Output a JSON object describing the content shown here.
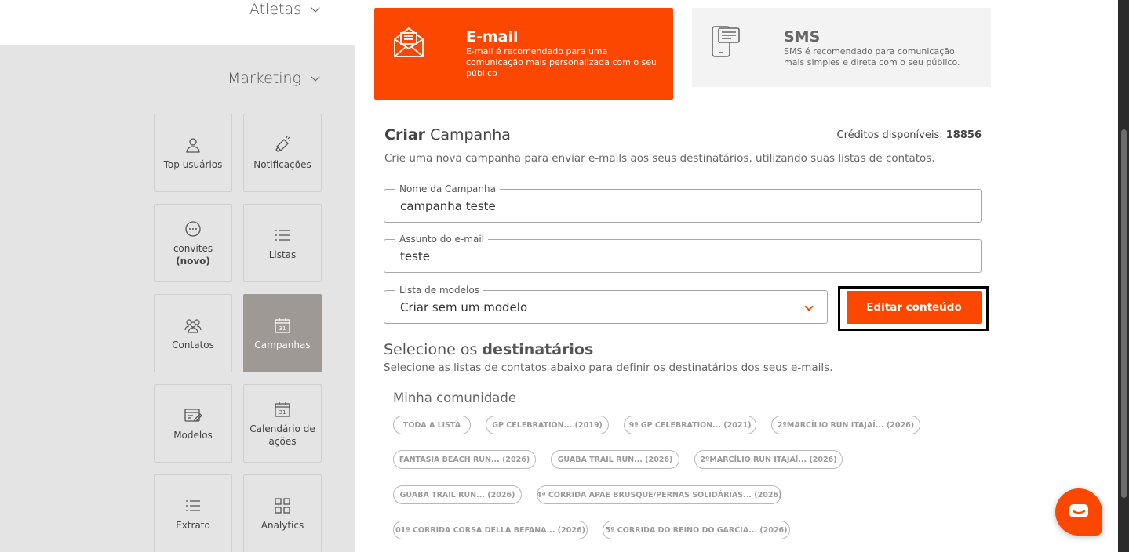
{
  "sidebar": {
    "atletas_label": "Atletas",
    "marketing_label": "Marketing",
    "tiles": [
      {
        "label": "Top usuários",
        "icon": "user-icon"
      },
      {
        "label": "Notificações",
        "icon": "megaphone-icon"
      },
      {
        "label": "convites",
        "label2": "(novo)",
        "icon": "chat-bubble-icon"
      },
      {
        "label": "Listas",
        "icon": "list-icon"
      },
      {
        "label": "Contatos",
        "icon": "group-icon"
      },
      {
        "label": "Campanhas",
        "icon": "calendar-icon",
        "active": true
      },
      {
        "label": "Modelos",
        "icon": "template-edit-icon"
      },
      {
        "label": "Calendário de ações",
        "icon": "calendar-icon"
      },
      {
        "label": "Extrato",
        "icon": "list-icon"
      },
      {
        "label": "Analytics",
        "icon": "grid-icon"
      }
    ]
  },
  "channels": {
    "email": {
      "title": "E-mail",
      "desc": "E-mail é recomendado para uma comunicação mais personalizada com o seu público",
      "icon": "envelope-icon"
    },
    "sms": {
      "title": "SMS",
      "desc": "SMS é recomendado para comunicação mais simples e direta com o seu público.",
      "icon": "phone-message-icon"
    }
  },
  "campaign": {
    "title_bold": "Criar",
    "title_rest": " Campanha",
    "credits_label": "Créditos disponíveis: ",
    "credits_value": "18856",
    "subtitle": "Crie uma nova campanha para enviar e-mails aos seus destinatários, utilizando suas listas de contatos.",
    "name_label": "Nome da Campanha",
    "name_value": "campanha teste",
    "subject_label": "Assunto do e-mail",
    "subject_value": "teste",
    "template_label": "Lista de modelos",
    "template_value": "Criar sem um modelo",
    "edit_button": "Editar conteúdo"
  },
  "recipients": {
    "title_rest": "Selecione os ",
    "title_bold": "destinatários",
    "subtitle": "Selecione as listas de contatos abaixo para definir os destinatários dos seus e-mails.",
    "group_title": "Minha comunidade",
    "chips": [
      "TODA A LISTA",
      "GP CELEBRATION... (2019)",
      "9ª GP CELEBRATION... (2021)",
      "2ºMARCÍLIO RUN ITAJAÍ... (2026)",
      "FANTASIA BEACH RUN... (2026)",
      "GUABA TRAIL RUN... (2026)",
      "2ºMARCÍLIO RUN ITAJAÍ... (2026)",
      "GUABA TRAIL RUN... (2026)",
      "4ª CORRIDA APAE BRUSQUE/PERNAS SOLIDÁRIAS... (2026)",
      "01ª CORRIDA CORSA DELLA BEFANA... (2026)",
      "5ª CORRIDA DO REINO DO GARCIA... (2026)"
    ]
  },
  "colors": {
    "accent": "#fc4700",
    "sidebar_bg": "#e4e4e4",
    "active_tile": "#9f9995"
  }
}
